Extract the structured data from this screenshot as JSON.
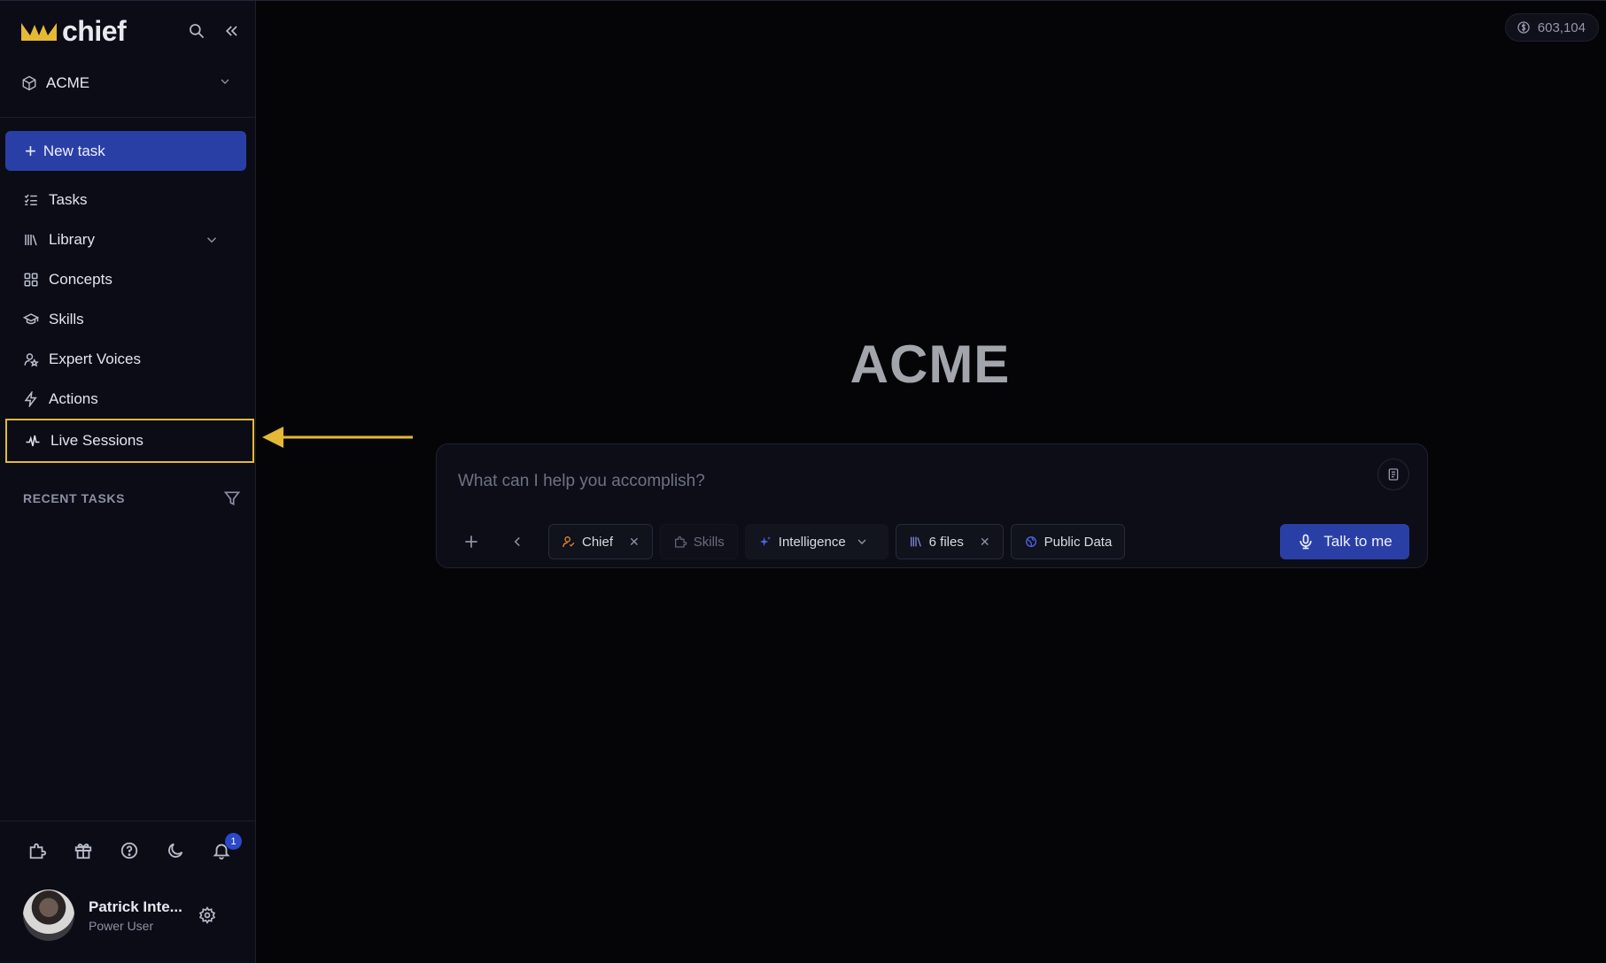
{
  "app": {
    "name": "chief",
    "brand_color": "#e5b935",
    "accent": "#2a3fa6"
  },
  "workspace": {
    "label": "ACME"
  },
  "sidebar": {
    "new_task_label": "New task",
    "items": [
      {
        "label": "Tasks",
        "icon": "list-checks-icon"
      },
      {
        "label": "Library",
        "icon": "library-icon"
      },
      {
        "label": "Concepts",
        "icon": "grid-icon"
      },
      {
        "label": "Skills",
        "icon": "graduation-cap-icon"
      },
      {
        "label": "Expert Voices",
        "icon": "user-star-icon"
      },
      {
        "label": "Actions",
        "icon": "bolt-icon"
      },
      {
        "label": "Live Sessions",
        "icon": "pulse-icon"
      }
    ],
    "recent_tasks_label": "RECENT TASKS",
    "notification_count": "1"
  },
  "user": {
    "name": "Patrick Inte...",
    "role": "Power User"
  },
  "credits": {
    "value": "603,104"
  },
  "main": {
    "title": "ACME",
    "prompt": {
      "placeholder": "What can I help you accomplish?",
      "chips": {
        "chief": "Chief",
        "skills": "Skills",
        "intelligence": "Intelligence",
        "files": "6 files",
        "public_data": "Public Data"
      },
      "talk_label": "Talk to me"
    }
  }
}
